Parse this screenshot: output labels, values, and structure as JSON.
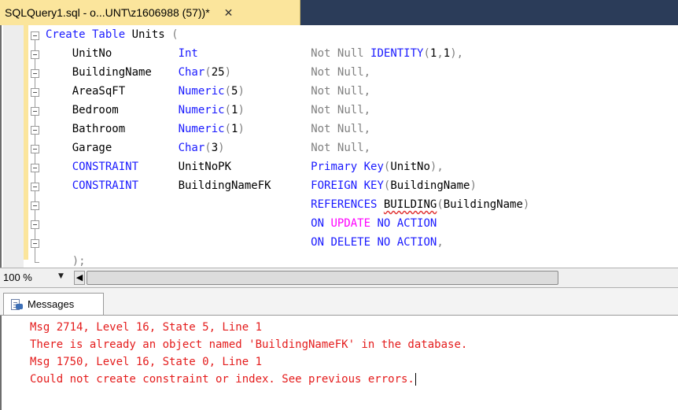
{
  "tab": {
    "title": "SQLQuery1.sql - o...UNT\\z1606988 (57))*",
    "close_glyph": "✕"
  },
  "editor": {
    "lines": [
      {
        "parts": [
          {
            "cls": "kw",
            "t": "Create Table "
          },
          {
            "cls": "nm",
            "t": "Units "
          },
          {
            "cls": "gr",
            "t": "("
          }
        ]
      },
      {
        "parts": [
          {
            "cls": "nm",
            "t": "    UnitNo          "
          },
          {
            "cls": "tp",
            "t": "Int"
          },
          {
            "cls": "nm",
            "t": "                 "
          },
          {
            "cls": "gr",
            "t": "Not Null "
          },
          {
            "cls": "kw",
            "t": "IDENTITY"
          },
          {
            "cls": "gr",
            "t": "("
          },
          {
            "cls": "nm",
            "t": "1"
          },
          {
            "cls": "gr",
            "t": ","
          },
          {
            "cls": "nm",
            "t": "1"
          },
          {
            "cls": "gr",
            "t": "),"
          }
        ]
      },
      {
        "parts": [
          {
            "cls": "nm",
            "t": "    BuildingName    "
          },
          {
            "cls": "tp",
            "t": "Char"
          },
          {
            "cls": "gr",
            "t": "("
          },
          {
            "cls": "nm",
            "t": "25"
          },
          {
            "cls": "gr",
            "t": ")"
          },
          {
            "cls": "nm",
            "t": "            "
          },
          {
            "cls": "gr",
            "t": "Not Null,"
          }
        ]
      },
      {
        "parts": [
          {
            "cls": "nm",
            "t": "    AreaSqFT        "
          },
          {
            "cls": "tp",
            "t": "Numeric"
          },
          {
            "cls": "gr",
            "t": "("
          },
          {
            "cls": "nm",
            "t": "5"
          },
          {
            "cls": "gr",
            "t": ")"
          },
          {
            "cls": "nm",
            "t": "          "
          },
          {
            "cls": "gr",
            "t": "Not Null,"
          }
        ]
      },
      {
        "parts": [
          {
            "cls": "nm",
            "t": "    Bedroom         "
          },
          {
            "cls": "tp",
            "t": "Numeric"
          },
          {
            "cls": "gr",
            "t": "("
          },
          {
            "cls": "nm",
            "t": "1"
          },
          {
            "cls": "gr",
            "t": ")"
          },
          {
            "cls": "nm",
            "t": "          "
          },
          {
            "cls": "gr",
            "t": "Not Null,"
          }
        ]
      },
      {
        "parts": [
          {
            "cls": "nm",
            "t": "    Bathroom        "
          },
          {
            "cls": "tp",
            "t": "Numeric"
          },
          {
            "cls": "gr",
            "t": "("
          },
          {
            "cls": "nm",
            "t": "1"
          },
          {
            "cls": "gr",
            "t": ")"
          },
          {
            "cls": "nm",
            "t": "          "
          },
          {
            "cls": "gr",
            "t": "Not Null,"
          }
        ]
      },
      {
        "parts": [
          {
            "cls": "nm",
            "t": "    Garage          "
          },
          {
            "cls": "tp",
            "t": "Char"
          },
          {
            "cls": "gr",
            "t": "("
          },
          {
            "cls": "nm",
            "t": "3"
          },
          {
            "cls": "gr",
            "t": ")"
          },
          {
            "cls": "nm",
            "t": "             "
          },
          {
            "cls": "gr",
            "t": "Not Null,"
          }
        ]
      },
      {
        "parts": [
          {
            "cls": "kw",
            "t": "    CONSTRAINT      "
          },
          {
            "cls": "nm",
            "t": "UnitNoPK            "
          },
          {
            "cls": "kw",
            "t": "Primary Key"
          },
          {
            "cls": "gr",
            "t": "("
          },
          {
            "cls": "nm",
            "t": "UnitNo"
          },
          {
            "cls": "gr",
            "t": "),"
          }
        ]
      },
      {
        "parts": [
          {
            "cls": "kw",
            "t": "    CONSTRAINT      "
          },
          {
            "cls": "nm",
            "t": "BuildingNameFK      "
          },
          {
            "cls": "kw",
            "t": "FOREIGN KEY"
          },
          {
            "cls": "gr",
            "t": "("
          },
          {
            "cls": "nm",
            "t": "BuildingName"
          },
          {
            "cls": "gr",
            "t": ")"
          }
        ]
      },
      {
        "parts": [
          {
            "cls": "nm",
            "t": "                                        "
          },
          {
            "cls": "kw",
            "t": "REFERENCES "
          },
          {
            "cls": "nm squig",
            "t": "BUILDING"
          },
          {
            "cls": "gr",
            "t": "("
          },
          {
            "cls": "nm",
            "t": "BuildingName"
          },
          {
            "cls": "gr",
            "t": ")"
          }
        ]
      },
      {
        "parts": [
          {
            "cls": "nm",
            "t": "                                        "
          },
          {
            "cls": "kw",
            "t": "ON "
          },
          {
            "cls": "pk",
            "t": "UPDATE"
          },
          {
            "cls": "kw",
            "t": " NO ACTION"
          }
        ]
      },
      {
        "parts": [
          {
            "cls": "nm",
            "t": "                                        "
          },
          {
            "cls": "kw",
            "t": "ON DELETE NO ACTION"
          },
          {
            "cls": "gr",
            "t": ","
          }
        ]
      },
      {
        "parts": [
          {
            "cls": "gr",
            "t": "    );"
          }
        ]
      }
    ]
  },
  "status": {
    "zoom": "100 %",
    "dropdown_glyph": "▼",
    "scroll_left_glyph": "◀"
  },
  "messages": {
    "tab_label": "Messages",
    "lines": [
      "Msg 2714, Level 16, State 5, Line 1",
      "There is already an object named 'BuildingNameFK' in the database.",
      "Msg 1750, Level 16, State 0, Line 1",
      "Could not create constraint or index. See previous errors."
    ]
  },
  "colors": {
    "error": "#e41c1c",
    "keyword": "#1a1aff",
    "punct": "#808080",
    "pink": "#ff00ff",
    "tab": "#fbe59c",
    "tabbar": "#2b3c59"
  }
}
